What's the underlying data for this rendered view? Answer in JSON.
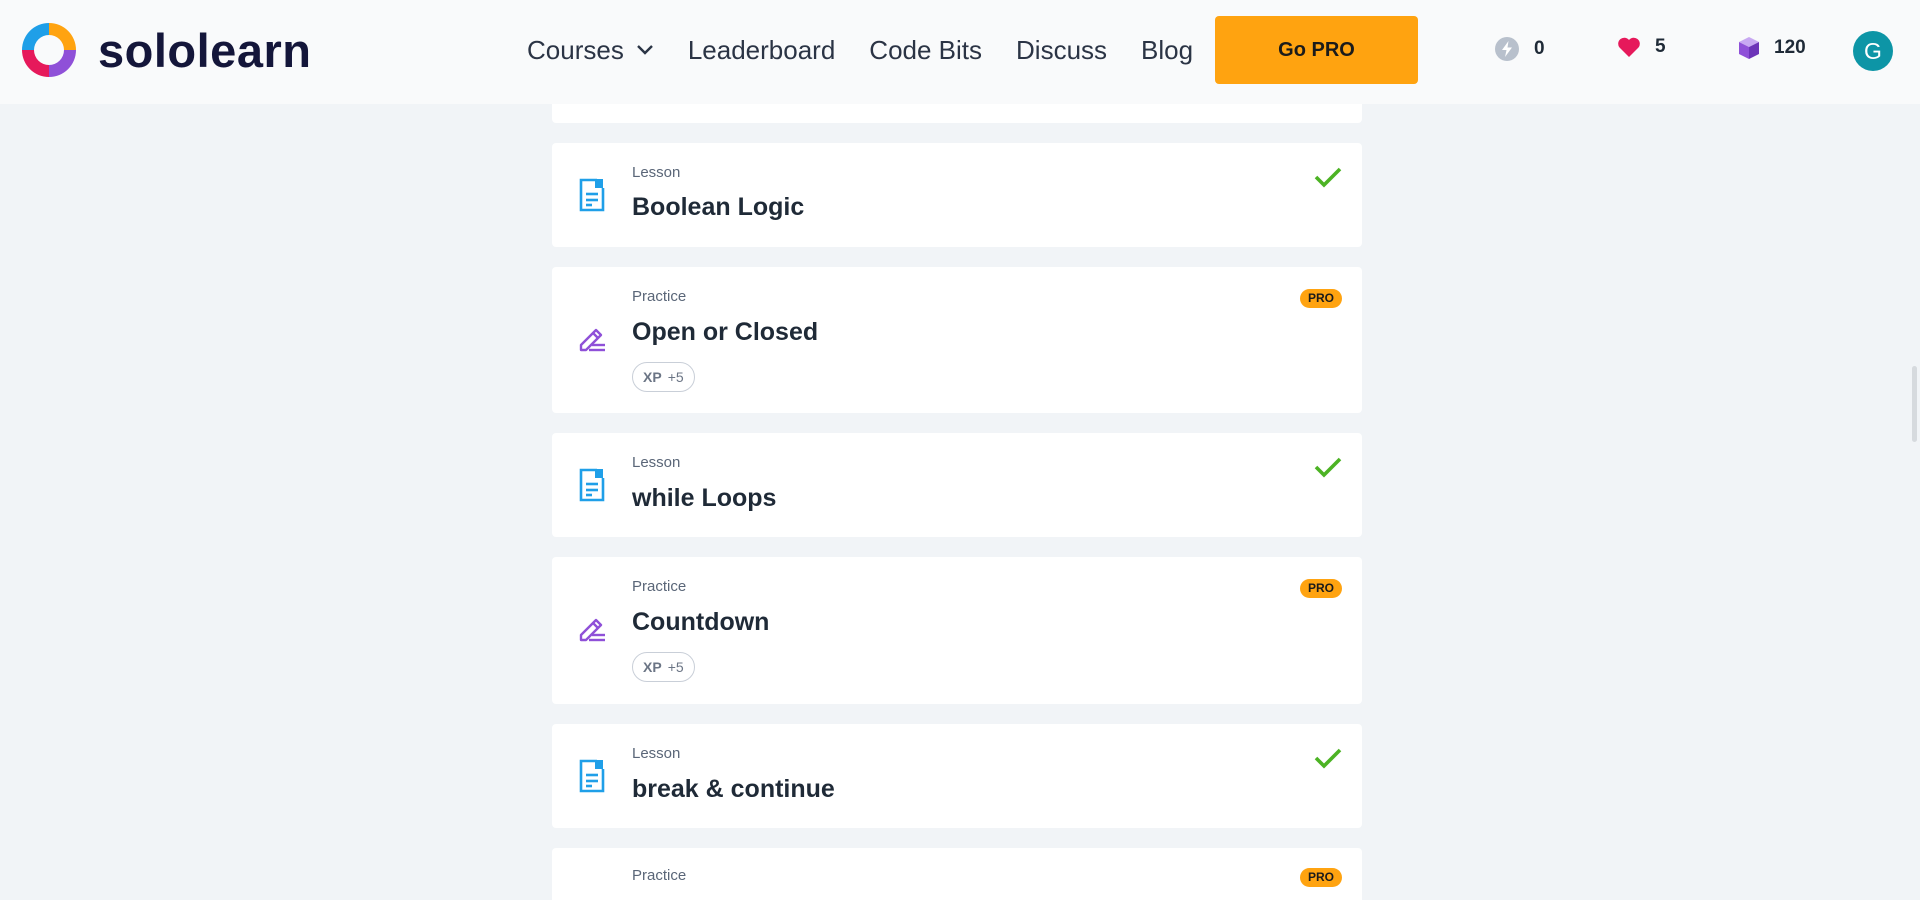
{
  "brand": {
    "name": "sololearn"
  },
  "nav": {
    "courses": "Courses",
    "leaderboard": "Leaderboard",
    "code_bits": "Code Bits",
    "discuss": "Discuss",
    "blog": "Blog"
  },
  "header": {
    "go_pro": "Go PRO",
    "streak": "0",
    "hearts": "5",
    "gems": "120",
    "avatar_initial": "G"
  },
  "colors": {
    "accent_orange": "#ffa310",
    "lesson_blue": "#1f9fe8",
    "practice_purple": "#8f50d8",
    "check_green": "#4cb324",
    "heart_pink": "#e6195b",
    "avatar_teal": "#0d95a6"
  },
  "items": [
    {
      "kind": "Lesson",
      "title": "Boolean Logic",
      "status": "completed"
    },
    {
      "kind": "Practice",
      "title": "Open or Closed",
      "badge": "PRO",
      "xp_label": "XP",
      "xp_value": "+5"
    },
    {
      "kind": "Lesson",
      "title": "while Loops",
      "status": "completed"
    },
    {
      "kind": "Practice",
      "title": "Countdown",
      "badge": "PRO",
      "xp_label": "XP",
      "xp_value": "+5"
    },
    {
      "kind": "Lesson",
      "title": "break & continue",
      "status": "completed"
    },
    {
      "kind": "Practice",
      "title": "",
      "badge": "PRO"
    }
  ]
}
